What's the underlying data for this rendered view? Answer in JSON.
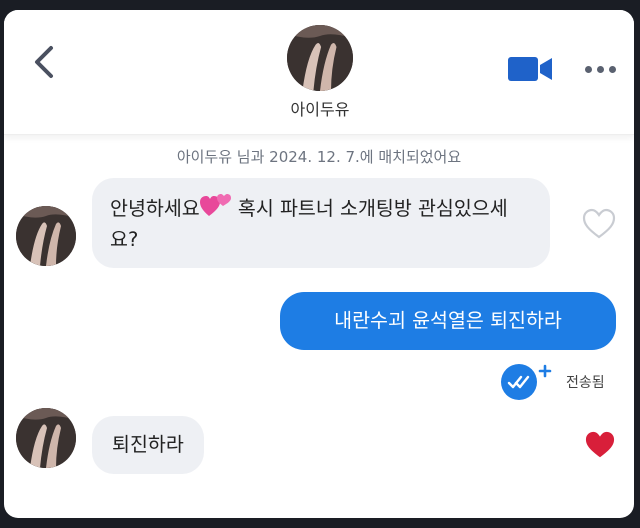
{
  "contact": {
    "name": "아이두유"
  },
  "match_info": "아이두유 님과 2024. 12. 7.에 매치되었어요",
  "messages": [
    {
      "direction": "incoming",
      "text_before_emoji": "안녕하세요",
      "emoji": "two-hearts",
      "text_after_emoji": " 혹시 파트너 소개팅방 관심있으세요?",
      "liked": false
    },
    {
      "direction": "outgoing",
      "text": "내란수괴 윤석열은 퇴진하라",
      "status": "전송됨"
    },
    {
      "direction": "incoming",
      "text": "퇴진하라",
      "liked": true
    }
  ],
  "icons": {
    "back": "chevron-left-icon",
    "video": "video-camera-icon",
    "more": "more-dots-icon",
    "like": "heart-icon",
    "read": "double-check-icon"
  },
  "colors": {
    "accent": "#1e7de4",
    "incoming_bubble": "#eef0f4",
    "heart_filled": "#d81f3a",
    "video_icon": "#1f62c9"
  }
}
